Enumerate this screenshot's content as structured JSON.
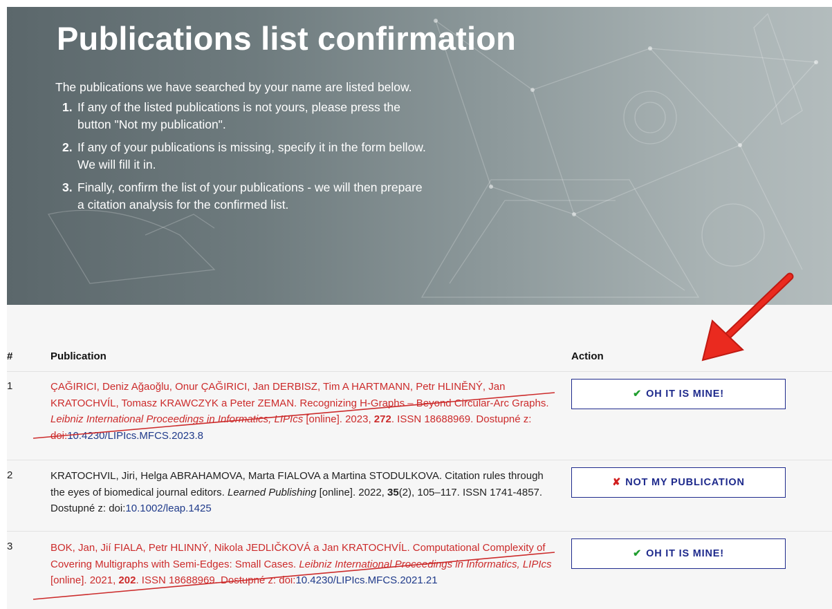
{
  "hero": {
    "title": "Publications list confirmation",
    "intro": "The publications we have searched by your name are listed below.",
    "steps": [
      {
        "num": "1.",
        "text": "If any of the listed publications is not yours, please press the button \"Not my publication\"."
      },
      {
        "num": "2.",
        "text": "If any of your publications is missing, specify it in the form bellow. We will fill it in."
      },
      {
        "num": "3.",
        "text": "Finally, confirm the list of your publications - we will then prepare a citation analysis for the confirmed list."
      }
    ]
  },
  "table": {
    "headers": {
      "num": "#",
      "publication": "Publication",
      "action": "Action"
    },
    "rows": [
      {
        "num": "1",
        "authors_title": "ÇAĞIRICI, Deniz Ağaoğlu, Onur ÇAĞIRICI, Jan DERBISZ, Tim A HARTMANN, Petr HLINĚNÝ, Jan KRATOCHVÍL, Tomasz KRAWCZYK a Peter ZEMAN. Recognizing H-Graphs – Beyond Circular-Arc Graphs.",
        "journal": "Leibniz International Proceedings in Informatics, LIPIcs",
        "after_journal": " [online]. 2023, ",
        "volume": "272",
        "issue": "",
        "rest": ". ISSN 18688969. Dostupné z: doi:",
        "doi": "10.4230/LIPIcs.MFCS.2023.8",
        "action_icon": "✔",
        "action_label": "OH IT IS MINE!"
      },
      {
        "num": "2",
        "authors_title": "KRATOCHVIL, Jiri, Helga ABRAHAMOVA, Marta FIALOVA a Martina STODULKOVA. Citation rules through the eyes of biomedical journal editors.",
        "journal": "Learned Publishing",
        "after_journal": " [online]. 2022, ",
        "volume": "35",
        "issue": "(2), 105–117",
        "rest": ". ISSN 1741-4857. Dostupné z: doi:",
        "doi": "10.1002/leap.1425",
        "action_icon": "✘",
        "action_label": "NOT MY PUBLICATION"
      },
      {
        "num": "3",
        "authors_title": "BOK, Jan, Jií FIALA, Petr HLINNÝ, Nikola JEDLIČKOVÁ a Jan KRATOCHVÍL. Computational Complexity of Covering Multigraphs with Semi-Edges: Small Cases.",
        "journal": "Leibniz International Proceedings in Informatics, LIPIcs",
        "after_journal": " [online]. 2021, ",
        "volume": "202",
        "issue": "",
        "rest": ". ISSN 18688969. Dostupné z: doi:",
        "doi": "10.4230/LIPIcs.MFCS.2021.21",
        "action_icon": "✔",
        "action_label": "OH IT IS MINE!"
      }
    ]
  },
  "colors": {
    "accent": "#1e2a8c",
    "struck_text": "#cc2b2b",
    "annotation_red": "#e8231c",
    "confirm_green": "#1f9d2e",
    "reject_red": "#d11f1f"
  }
}
